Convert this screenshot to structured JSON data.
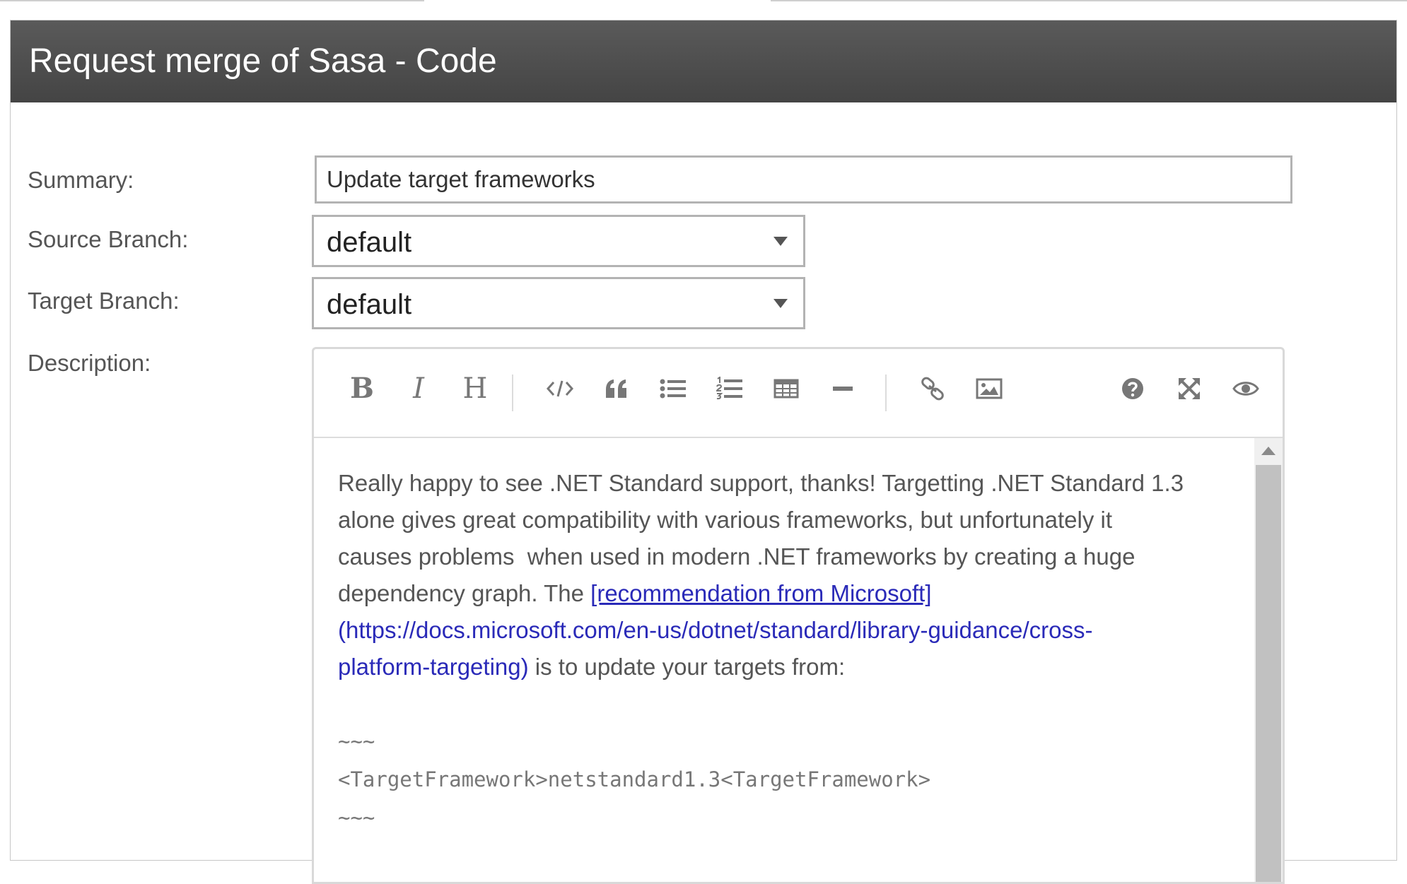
{
  "dialog": {
    "title": "Request merge of Sasa - Code"
  },
  "form": {
    "summary_label": "Summary:",
    "summary_value": "Update target frameworks",
    "source_branch_label": "Source Branch:",
    "source_branch_value": "default",
    "target_branch_label": "Target Branch:",
    "target_branch_value": "default",
    "description_label": "Description:"
  },
  "toolbar": {
    "bold": "B",
    "italic": "I",
    "heading": "H",
    "icons": [
      "bold-icon",
      "italic-icon",
      "heading-icon",
      "code-icon",
      "quote-icon",
      "unordered-list-icon",
      "ordered-list-icon",
      "table-icon",
      "horizontal-rule-icon",
      "link-icon",
      "image-icon",
      "help-icon",
      "fullscreen-icon",
      "preview-icon"
    ]
  },
  "description": {
    "line1": "Really happy to see .NET Standard support, thanks! Targetting .NET Standard 1.3",
    "line2": "alone gives great compatibility with various frameworks, but unfortunately it",
    "line3": "causes problems  when used in modern .NET frameworks by creating a huge",
    "line4_prefix": "dependency graph. The ",
    "link_text": "[recommendation from Microsoft]",
    "url_line1": "(https://docs.microsoft.com/en-us/dotnet/standard/library-guidance/cross-",
    "url_line2": "platform-targeting)",
    "line6_suffix": " is to update your targets from:",
    "code_fence_open": "~~~",
    "code_line": "<TargetFramework>netstandard1.3<TargetFramework>",
    "code_fence_close": "~~~"
  },
  "colors": {
    "header_bg": "#4f4f4f",
    "link": "#2a2ab8",
    "icon": "#777777"
  }
}
